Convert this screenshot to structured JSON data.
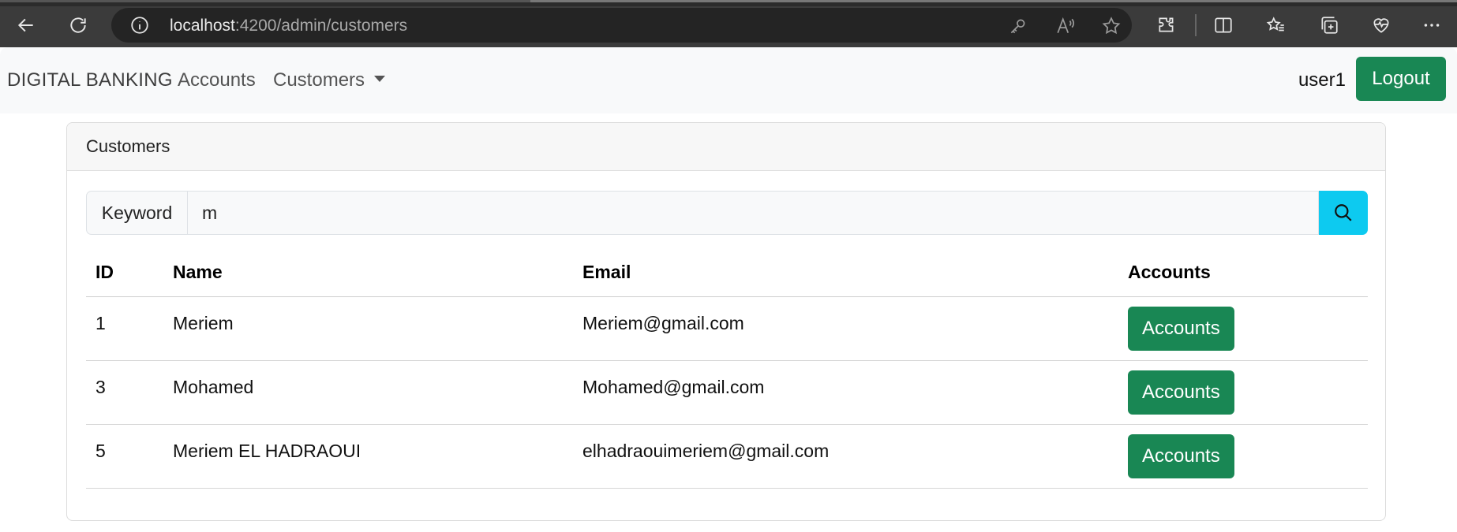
{
  "browser": {
    "url_host": "localhost",
    "url_path": ":4200/admin/customers"
  },
  "navbar": {
    "brand": "DIGITAL BANKING",
    "links": [
      "Accounts",
      "Customers"
    ],
    "username": "user1",
    "logout_label": "Logout"
  },
  "card": {
    "title": "Customers",
    "search": {
      "label": "Keyword",
      "value": "m"
    },
    "table": {
      "headers": [
        "ID",
        "Name",
        "Email",
        "Accounts"
      ],
      "rows": [
        {
          "id": "1",
          "name": "Meriem",
          "email": "Meriem@gmail.com",
          "action": "Accounts"
        },
        {
          "id": "3",
          "name": "Mohamed",
          "email": "Mohamed@gmail.com",
          "action": "Accounts"
        },
        {
          "id": "5",
          "name": "Meriem EL HADRAOUI",
          "email": "elhadraouimeriem@gmail.com",
          "action": "Accounts"
        }
      ]
    }
  },
  "colors": {
    "success": "#198754",
    "info": "#0dcaf0",
    "navbar_bg": "#f8f9fa"
  }
}
